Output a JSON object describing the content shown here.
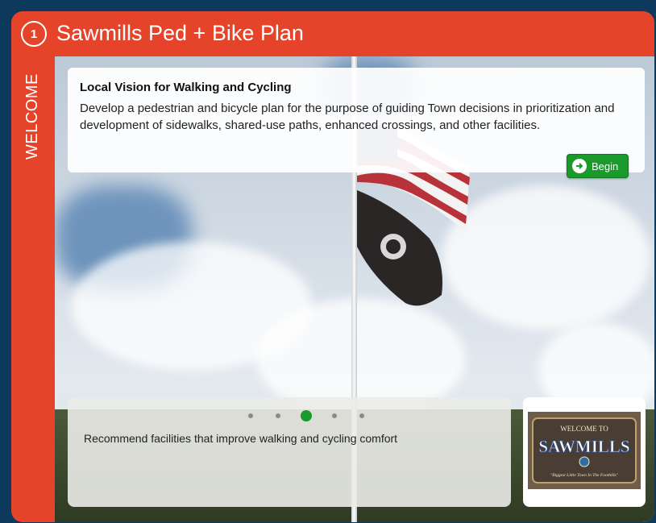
{
  "header": {
    "step_number": "1",
    "title": "Sawmills Ped + Bike Plan"
  },
  "side_label": "WELCOME",
  "vision": {
    "heading": "Local Vision for Walking and Cycling",
    "text": "Develop a pedestrian and bicycle plan for the purpose of guiding Town decisions in prioritization and development of sidewalks, shared-use paths, enhanced crossings, and other facilities.",
    "begin_label": "Begin"
  },
  "carousel": {
    "slide_count": 5,
    "active_index": 2,
    "text": "Recommend facilities that improve walking and cycling comfort"
  },
  "logo": {
    "line1": "WELCOME TO",
    "name": "SAWMILLS",
    "tagline": "Biggest Little Town In The Foothills"
  },
  "colors": {
    "panel": "#e5432a",
    "accent_green": "#1a9a2a",
    "background": "#0d3a5c"
  }
}
